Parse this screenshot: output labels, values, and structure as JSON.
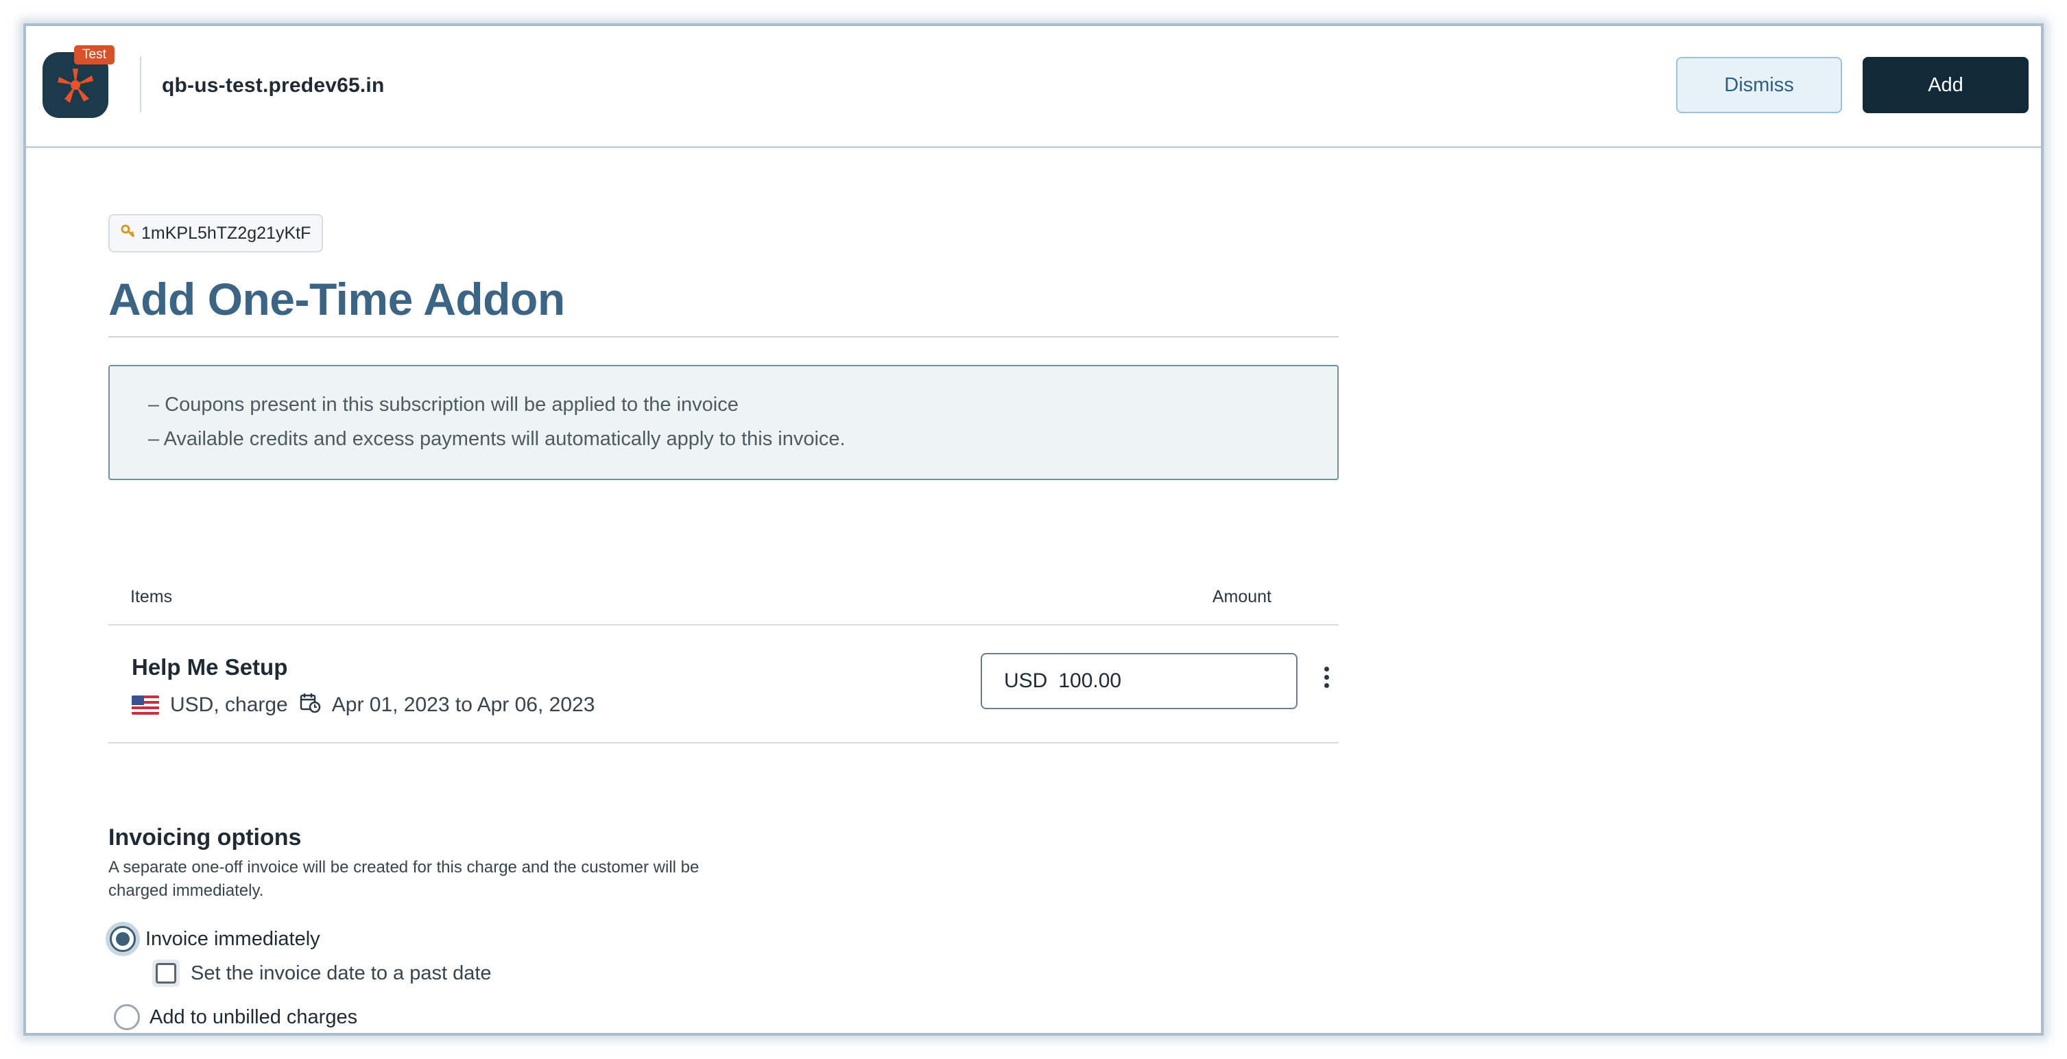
{
  "header": {
    "badge": "Test",
    "site": "qb-us-test.predev65.in",
    "dismiss_label": "Dismiss",
    "add_label": "Add"
  },
  "record": {
    "key_icon": "key-icon",
    "id": "1mKPL5hTZ2g21yKtF"
  },
  "page": {
    "title": "Add One-Time Addon"
  },
  "notice": {
    "lines": [
      "– Coupons present in this subscription will be applied to the invoice",
      "– Available credits and excess payments will automatically apply to this invoice."
    ]
  },
  "table": {
    "headers": {
      "items": "Items",
      "amount": "Amount"
    },
    "rows": [
      {
        "name": "Help Me Setup",
        "meta": "USD, charge",
        "period": "Apr 01, 2023 to Apr 06, 2023",
        "currency": "USD",
        "amount": "100.00"
      }
    ]
  },
  "invoicing": {
    "title": "Invoicing options",
    "description": "A separate one-off invoice will be created for this charge and the customer will be charged immediately.",
    "options": [
      {
        "label": "Invoice immediately",
        "selected": true
      },
      {
        "label": "Add to unbilled charges",
        "selected": false
      }
    ],
    "past_date_label": "Set the invoice date to a past date",
    "past_date_checked": false
  },
  "colors": {
    "accent": "#3b6485",
    "primary_button": "#122a38",
    "badge": "#d6532a"
  }
}
